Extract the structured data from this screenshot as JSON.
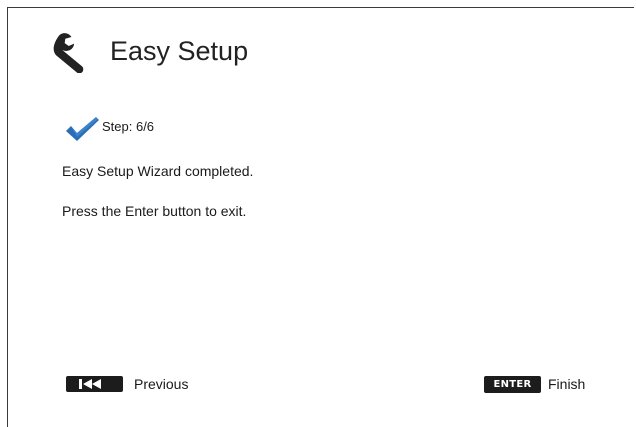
{
  "header": {
    "title": "Easy Setup",
    "icon": "wrench-icon"
  },
  "wizard": {
    "step_label": "Step: 6/6",
    "message_completed": "Easy Setup Wizard completed.",
    "message_instruction": "Press the Enter button to exit.",
    "status_icon": "checkmark-icon",
    "accent_color": "#2a6fb5"
  },
  "footer": {
    "previous": {
      "key_icon": "skip-back-icon",
      "label": "Previous"
    },
    "finish": {
      "key_label": "ENTER",
      "label": "Finish"
    }
  }
}
